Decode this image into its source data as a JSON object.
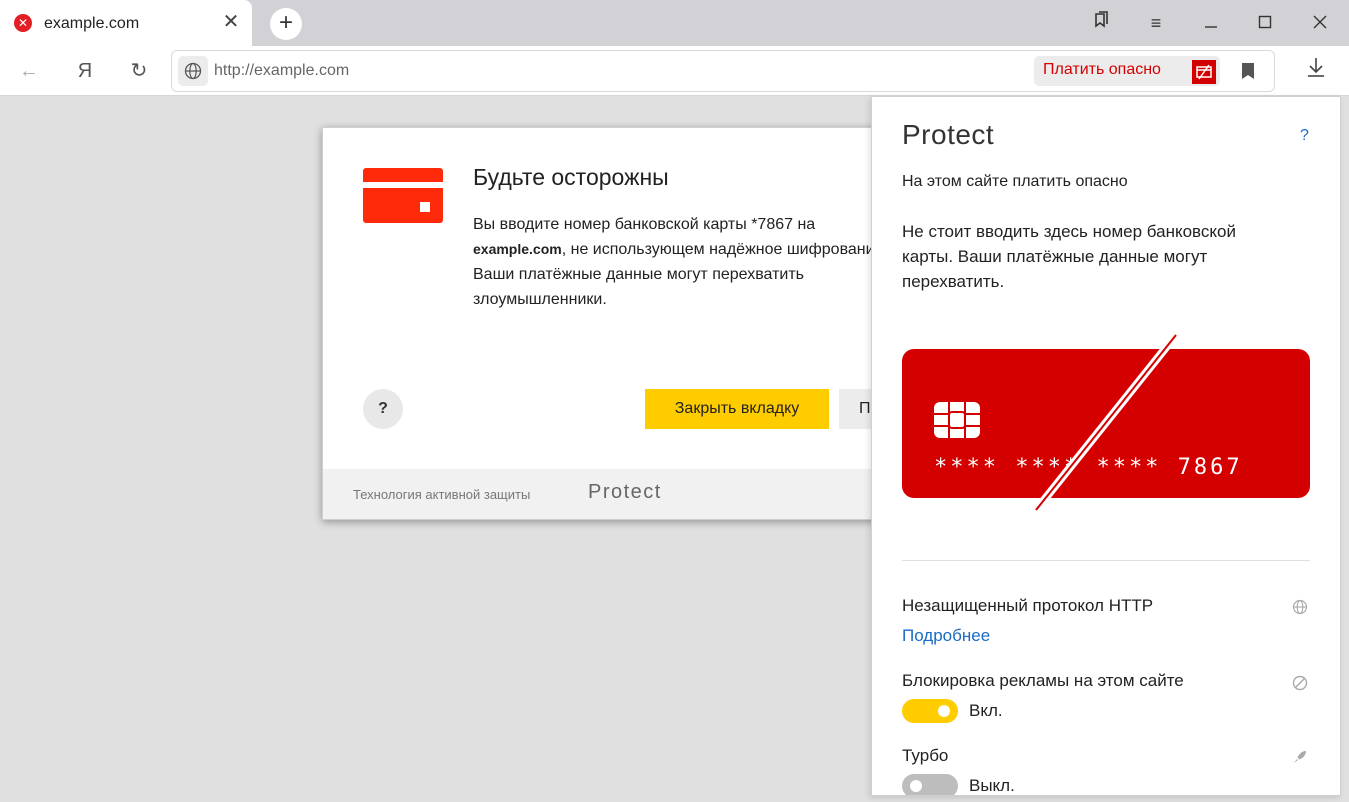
{
  "tab": {
    "title": "example.com",
    "close": "✕"
  },
  "window": {
    "menu": "≡"
  },
  "toolbar": {
    "back": "←",
    "yandex": "Я",
    "reload": "↻",
    "url": "http://example.com",
    "pay_warning": "Платить опасно"
  },
  "dialog": {
    "title": "Будьте осторожны",
    "line1": "Вы вводите номер банковской карты *7867 на",
    "line2_site": "example.com",
    "line2_rest": ", не использующем надёжное шифрование.",
    "line3": "Ваши платёжные данные могут перехватить",
    "line4": "злоумышленники.",
    "help": "?",
    "close_tab_button": "Закрыть вкладку",
    "continue_button": "П",
    "footer_text": "Технология активной защиты",
    "footer_logo": "Protect"
  },
  "panel": {
    "logo": "Protect",
    "help": "?",
    "heading": "На этом сайте платить опасно",
    "description": "Не стоит вводить здесь номер банковской карты. Ваши платёжные данные могут перехватить.",
    "card_number": "**** **** **** 7867",
    "http_label": "Незащищенный протокол HTTP",
    "more_link": "Подробнее",
    "adblock_label": "Блокировка рекламы на этом сайте",
    "adblock_state": "Вкл.",
    "turbo_label": "Турбо",
    "turbo_state": "Выкл."
  },
  "colors": {
    "danger": "#d40000",
    "accent_yellow": "#ffcc00",
    "link": "#1a6cc4"
  },
  "icons": {
    "favicon": "error-icon",
    "omnibox": "globe-icon",
    "http_row": "globe-icon",
    "adblock_row": "block-icon",
    "turbo_row": "rocket-icon"
  }
}
